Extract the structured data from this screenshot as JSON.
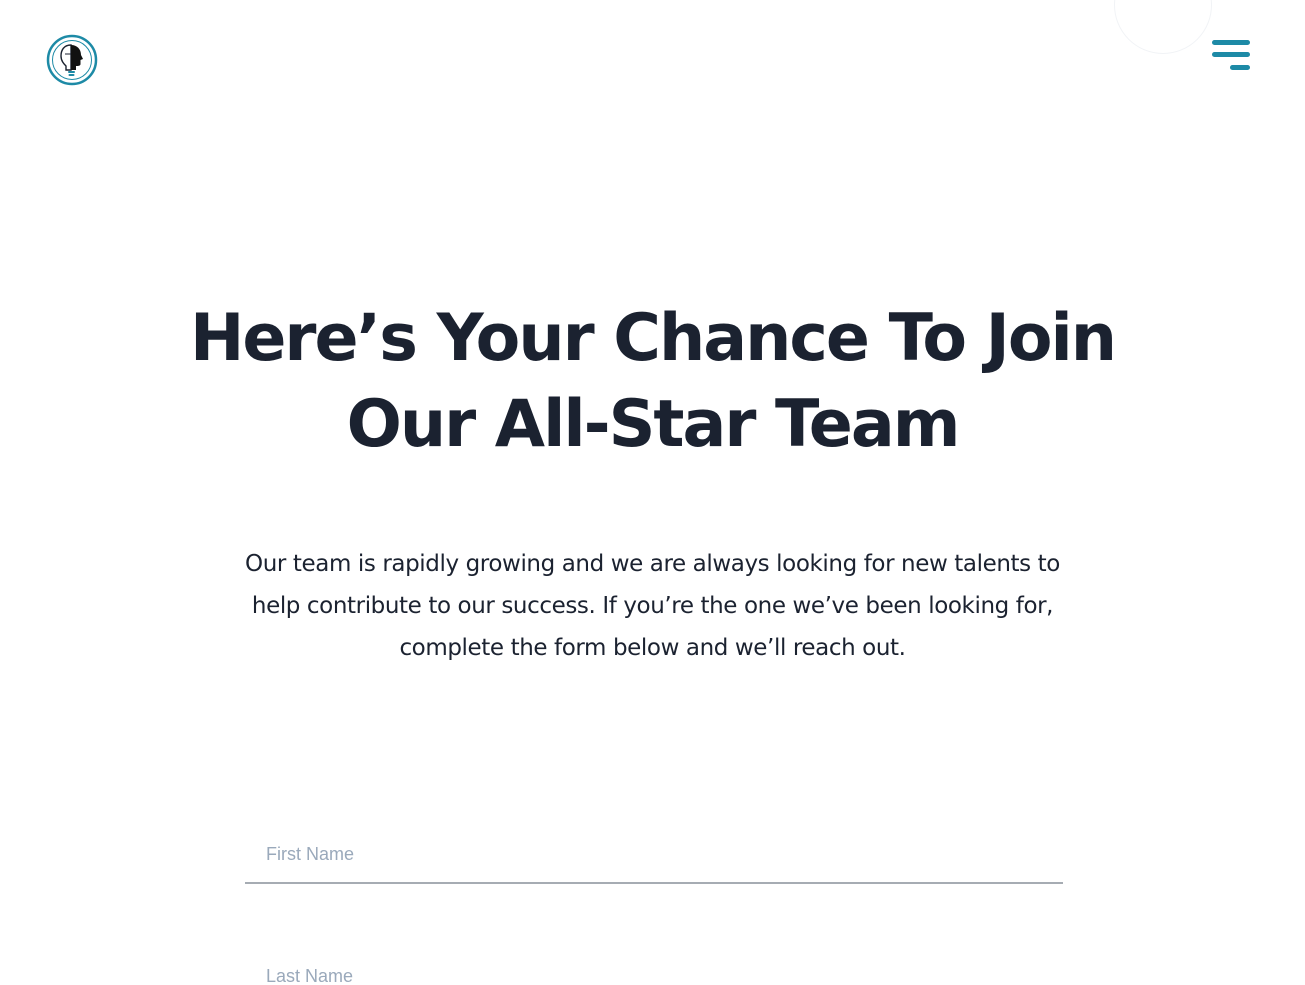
{
  "header": {
    "logo_icon": "head-profile-logo-icon",
    "menu_icon": "hamburger-menu-icon",
    "accent_color": "#1d8aa6"
  },
  "hero": {
    "headline_line1": "Here’s Your Chance To Join",
    "headline_line2": "Our All-Star Team",
    "intro_line1": "Our team is rapidly growing and we are always looking for new talents to",
    "intro_line2": "help contribute to our success. If you’re the one we’ve been looking for,",
    "intro_line3": "complete the form below and we’ll reach out."
  },
  "form": {
    "first_name": {
      "value": "",
      "placeholder": "First Name"
    },
    "last_name": {
      "value": "",
      "placeholder": "Last Name"
    }
  }
}
